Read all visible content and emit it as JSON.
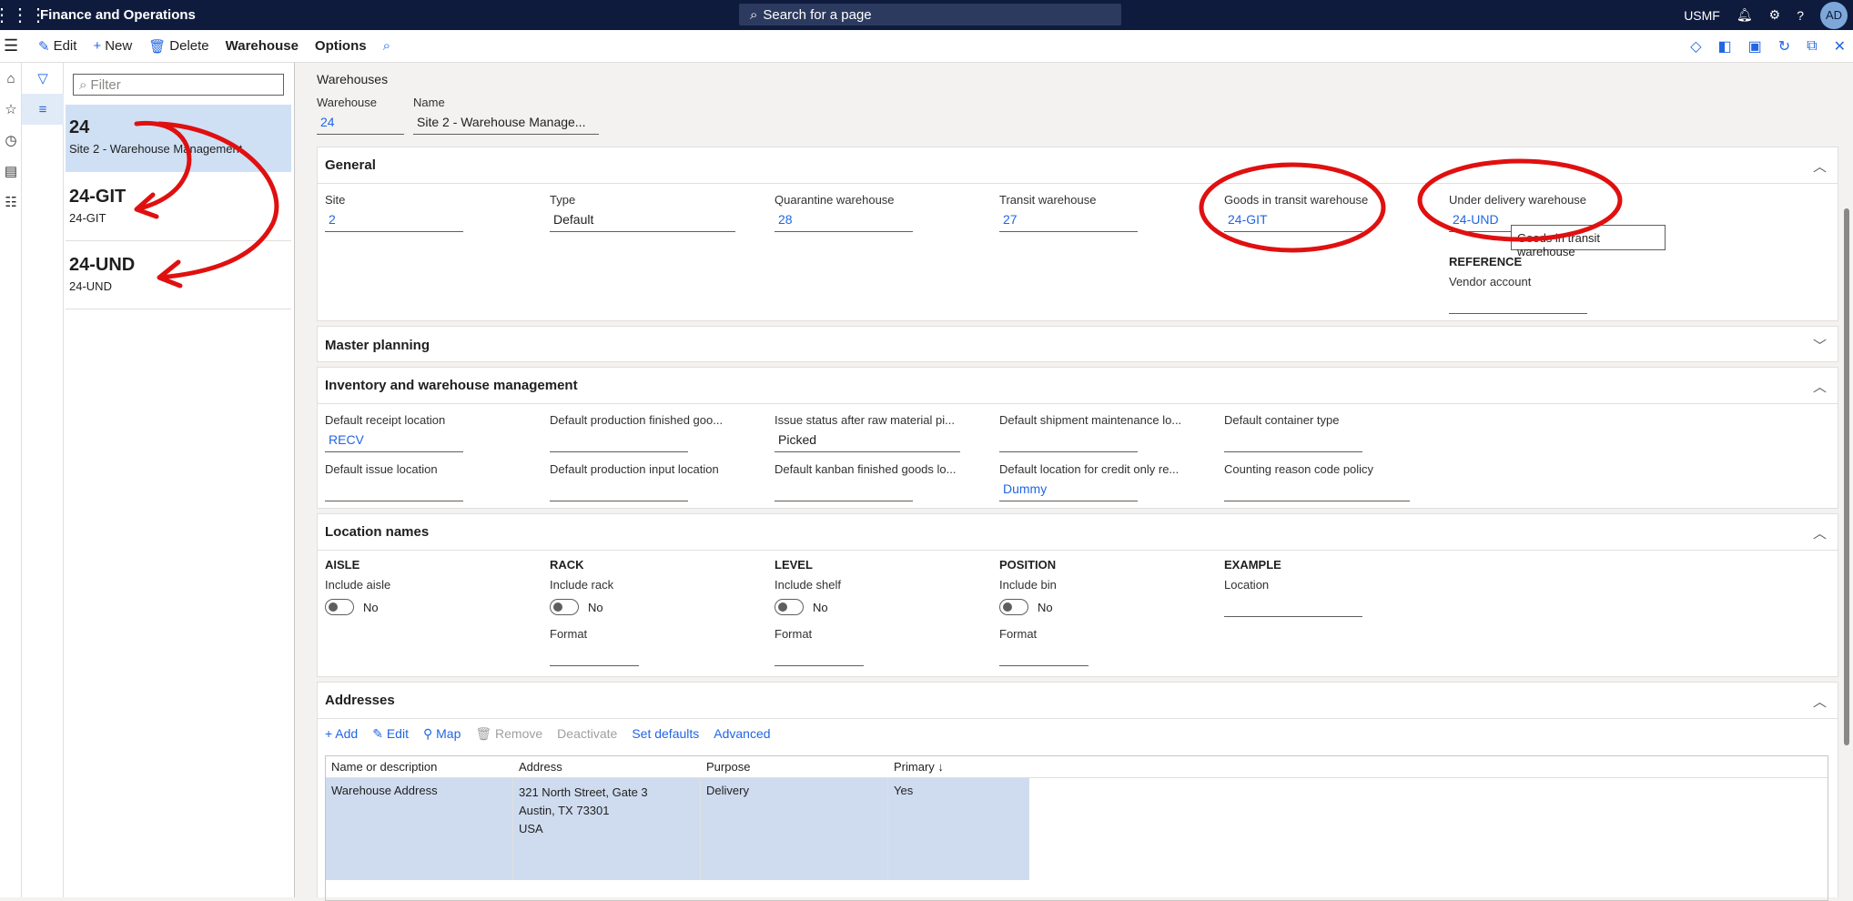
{
  "topbar": {
    "app_title": "Finance and Operations",
    "search_placeholder": "Search for a page",
    "company": "USMF",
    "avatar_initials": "AD"
  },
  "actionbar": {
    "edit": "Edit",
    "new": "New",
    "delete": "Delete",
    "warehouse": "Warehouse",
    "options": "Options"
  },
  "listpane": {
    "filter_placeholder": "Filter",
    "records": [
      {
        "id": "24",
        "name": "Site 2 - Warehouse Management"
      },
      {
        "id": "24-GIT",
        "name": "24-GIT"
      },
      {
        "id": "24-UND",
        "name": "24-UND"
      }
    ]
  },
  "page": {
    "caption": "Warehouses",
    "warehouse_label": "Warehouse",
    "warehouse_value": "24",
    "name_label": "Name",
    "name_value": "Site 2 - Warehouse Manage..."
  },
  "general": {
    "title": "General",
    "site_label": "Site",
    "site_value": "2",
    "type_label": "Type",
    "type_value": "Default",
    "quarantine_label": "Quarantine warehouse",
    "quarantine_value": "28",
    "transit_label": "Transit warehouse",
    "transit_value": "27",
    "git_label": "Goods in transit warehouse",
    "git_value": "24-GIT",
    "und_label": "Under delivery warehouse",
    "und_value": "24-UND",
    "reference_label": "REFERENCE",
    "vendor_label": "Vendor account",
    "tooltip": "Goods in transit warehouse"
  },
  "master_planning": {
    "title": "Master planning"
  },
  "inventory": {
    "title": "Inventory and warehouse management",
    "f1_label": "Default receipt location",
    "f1_value": "RECV",
    "f2_label": "Default production finished goo...",
    "f3_label": "Issue status after raw material pi...",
    "f3_value": "Picked",
    "f4_label": "Default shipment maintenance lo...",
    "f5_label": "Default container type",
    "f6_label": "Default issue location",
    "f7_label": "Default production input location",
    "f8_label": "Default kanban finished goods lo...",
    "f9_label": "Default location for credit only re...",
    "f9_value": "Dummy",
    "f10_label": "Counting reason code policy"
  },
  "location_names": {
    "title": "Location names",
    "aisle": "AISLE",
    "aisle_inc": "Include aisle",
    "rack": "RACK",
    "rack_inc": "Include rack",
    "level": "LEVEL",
    "level_inc": "Include shelf",
    "position": "POSITION",
    "position_inc": "Include bin",
    "example": "EXAMPLE",
    "location": "Location",
    "no": "No",
    "format": "Format"
  },
  "addresses": {
    "title": "Addresses",
    "add": "Add",
    "edit": "Edit",
    "map": "Map",
    "remove": "Remove",
    "deactivate": "Deactivate",
    "set_defaults": "Set defaults",
    "advanced": "Advanced",
    "col_name": "Name or description",
    "col_address": "Address",
    "col_purpose": "Purpose",
    "col_primary": "Primary ↓",
    "row_name": "Warehouse Address",
    "row_address_1": "321 North Street, Gate 3",
    "row_address_2": "Austin, TX 73301",
    "row_address_3": "USA",
    "row_purpose": "Delivery",
    "row_primary": "Yes"
  }
}
